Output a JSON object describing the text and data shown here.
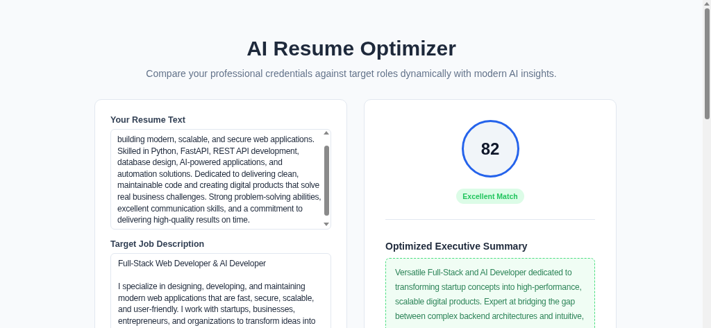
{
  "header": {
    "title": "AI Resume Optimizer",
    "subtitle": "Compare your professional credentials against target roles dynamically with modern AI insights."
  },
  "input_panel": {
    "resume": {
      "label": "Your Resume Text",
      "value": "building modern, scalable, and secure web applications. Skilled in Python, FastAPI, REST API development, database design, AI-powered applications, and automation solutions. Dedicated to delivering clean, maintainable code and creating digital products that solve real business challenges. Strong problem-solving abilities, excellent communication skills, and a commitment to delivering high-quality results on time."
    },
    "job": {
      "label": "Target Job Description",
      "value": "Full-Stack Web Developer & AI Developer\n\nI specialize in designing, developing, and maintaining modern web applications that are fast, secure, scalable, and user-friendly. I work with startups, businesses, entrepreneurs, and organizations to transform ideas into"
    }
  },
  "result_panel": {
    "score": "82",
    "rating": "Excellent Match",
    "summary_title": "Optimized Executive Summary",
    "summary": "Versatile Full-Stack and AI Developer dedicated to transforming startup concepts into high-performance, scalable digital products. Expert at bridging the gap between complex backend architectures and intuitive,"
  }
}
